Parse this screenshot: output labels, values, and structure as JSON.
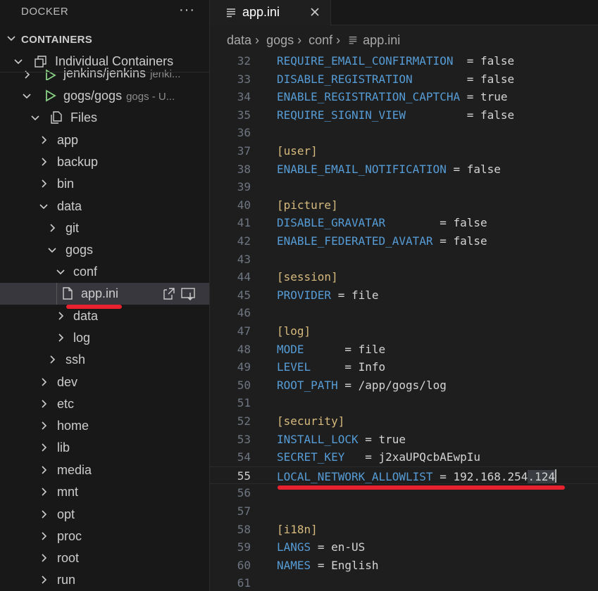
{
  "sidebar": {
    "title": "DOCKER",
    "more": "···",
    "section": "CONTAINERS",
    "group": "Individual Containers",
    "items": [
      {
        "label": "jenkins/jenkins",
        "desc": "jenki..."
      },
      {
        "label": "gogs/gogs",
        "desc": "gogs - U..."
      },
      {
        "label": "Files"
      },
      {
        "label": "app"
      },
      {
        "label": "backup"
      },
      {
        "label": "bin"
      },
      {
        "label": "data"
      },
      {
        "label": "git"
      },
      {
        "label": "gogs"
      },
      {
        "label": "conf"
      },
      {
        "label": "app.ini"
      },
      {
        "label": "data"
      },
      {
        "label": "log"
      },
      {
        "label": "ssh"
      },
      {
        "label": "dev"
      },
      {
        "label": "etc"
      },
      {
        "label": "home"
      },
      {
        "label": "lib"
      },
      {
        "label": "media"
      },
      {
        "label": "mnt"
      },
      {
        "label": "opt"
      },
      {
        "label": "proc"
      },
      {
        "label": "root"
      },
      {
        "label": "run"
      }
    ]
  },
  "editor": {
    "tab": {
      "label": "app.ini",
      "close": "✕"
    },
    "breadcrumbs": [
      "data",
      "gogs",
      "conf",
      "app.ini"
    ],
    "lines": [
      {
        "n": "32",
        "key": "REQUIRE_EMAIL_CONFIRMATION",
        "pad": "  ",
        "val": "false"
      },
      {
        "n": "33",
        "key": "DISABLE_REGISTRATION",
        "pad": "        ",
        "val": "false"
      },
      {
        "n": "34",
        "key": "ENABLE_REGISTRATION_CAPTCHA",
        "pad": " ",
        "val": "true"
      },
      {
        "n": "35",
        "key": "REQUIRE_SIGNIN_VIEW",
        "pad": "         ",
        "val": "false"
      },
      {
        "n": "36"
      },
      {
        "n": "37",
        "section": "[user]"
      },
      {
        "n": "38",
        "key": "ENABLE_EMAIL_NOTIFICATION",
        "pad": " ",
        "val": "false"
      },
      {
        "n": "39"
      },
      {
        "n": "40",
        "section": "[picture]"
      },
      {
        "n": "41",
        "key": "DISABLE_GRAVATAR",
        "pad": "        ",
        "val": "false"
      },
      {
        "n": "42",
        "key": "ENABLE_FEDERATED_AVATAR",
        "pad": " ",
        "val": "false"
      },
      {
        "n": "43"
      },
      {
        "n": "44",
        "section": "[session]"
      },
      {
        "n": "45",
        "key": "PROVIDER",
        "pad": " ",
        "val": "file"
      },
      {
        "n": "46"
      },
      {
        "n": "47",
        "section": "[log]"
      },
      {
        "n": "48",
        "key": "MODE",
        "pad": "      ",
        "val": "file"
      },
      {
        "n": "49",
        "key": "LEVEL",
        "pad": "     ",
        "val": "Info"
      },
      {
        "n": "50",
        "key": "ROOT_PATH",
        "pad": " ",
        "val": "/app/gogs/log"
      },
      {
        "n": "51"
      },
      {
        "n": "52",
        "section": "[security]"
      },
      {
        "n": "53",
        "key": "INSTALL_LOCK",
        "pad": " ",
        "val": "true"
      },
      {
        "n": "54",
        "key": "SECRET_KEY",
        "pad": "   ",
        "val": "j2xaUPQcbAEwpIu"
      },
      {
        "n": "55",
        "key": "LOCAL_NETWORK_ALLOWLIST",
        "pad": " ",
        "val": "192.168.254",
        "sel": ".124",
        "current": true
      },
      {
        "n": "56"
      },
      {
        "n": "57"
      },
      {
        "n": "58",
        "section": "[i18n]"
      },
      {
        "n": "59",
        "key": "LANGS",
        "pad": " ",
        "val": "en-US"
      },
      {
        "n": "60",
        "key": "NAMES",
        "pad": " ",
        "val": "English"
      },
      {
        "n": "61"
      }
    ]
  },
  "colors": {
    "accent_red": "#e8212f",
    "key": "#569cd6",
    "section": "#d7ba7d",
    "run_icon": "#89d185"
  }
}
